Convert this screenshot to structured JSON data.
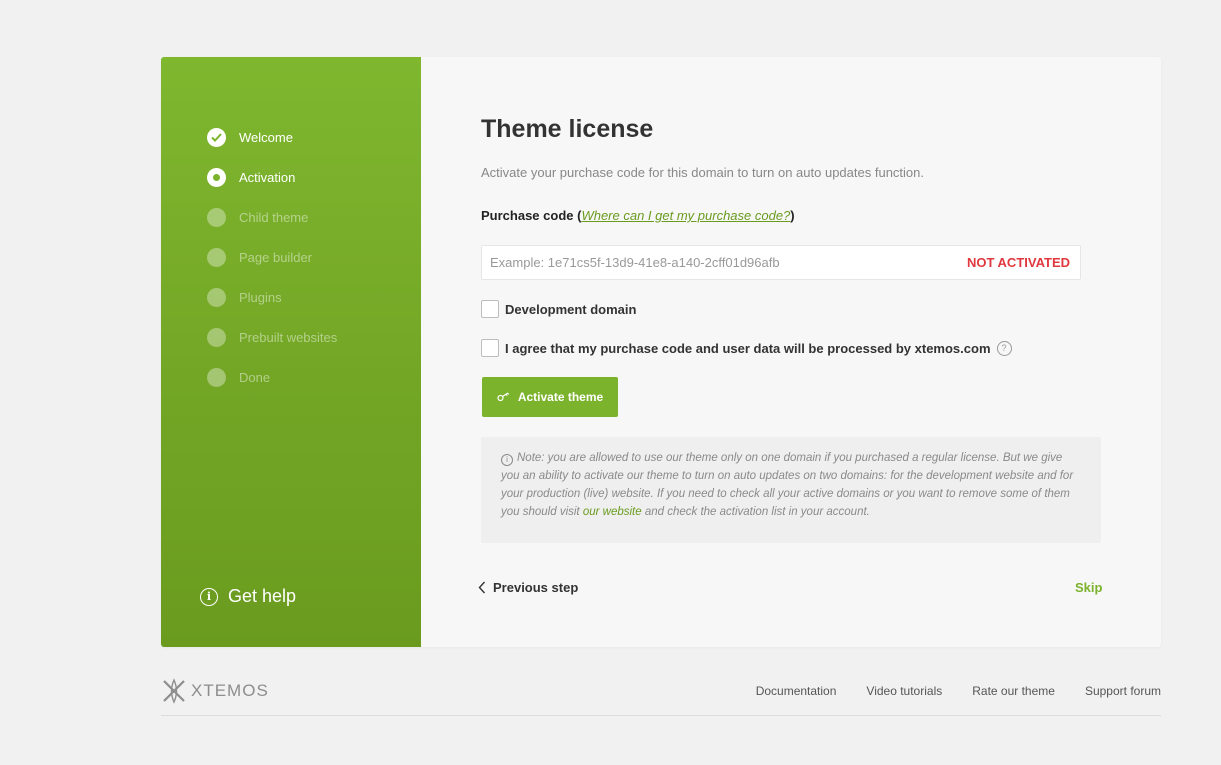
{
  "sidebar": {
    "steps": [
      {
        "label": "Welcome",
        "state": "done"
      },
      {
        "label": "Activation",
        "state": "active"
      },
      {
        "label": "Child theme",
        "state": "pending"
      },
      {
        "label": "Page builder",
        "state": "pending"
      },
      {
        "label": "Plugins",
        "state": "pending"
      },
      {
        "label": "Prebuilt websites",
        "state": "pending"
      },
      {
        "label": "Done",
        "state": "pending"
      }
    ],
    "help_label": "Get help"
  },
  "main": {
    "title": "Theme license",
    "subtitle": "Activate your purchase code for this domain to turn on auto updates function.",
    "purchase_label": "Purchase code",
    "purchase_link": "Where can I get my purchase code?",
    "code_input": {
      "value": "",
      "placeholder": "Example: 1e71cs5f-13d9-41e8-a140-2cff01d96afb"
    },
    "status": "NOT ACTIVATED",
    "dev_domain_label": "Development domain",
    "agree_label": "I agree that my purchase code and user data will be processed by xtemos.com",
    "activate_label": "Activate theme",
    "note": {
      "text_before": "Note: you are allowed to use our theme only on one domain if you purchased a regular license. But we give you an ability to activate our theme to turn on auto updates on two domains: for the development website and for your production (live) website. If you need to check all your active domains or you want to remove some of them you should visit ",
      "link": "our website",
      "text_after": " and check the activation list in your account."
    },
    "prev_label": "Previous step",
    "skip_label": "Skip"
  },
  "footer": {
    "logo_text": "XTEMOS",
    "links": [
      "Documentation",
      "Video tutorials",
      "Rate our theme",
      "Support forum"
    ]
  },
  "colors": {
    "accent": "#7cb32c",
    "status_error": "#e0383e"
  },
  "icons": {
    "done": "check-icon",
    "help": "info-circle-icon",
    "key": "key-icon",
    "prev": "chevron-left-icon",
    "question": "question-circle-icon",
    "note": "info-icon",
    "logo": "xtemos-logo-icon"
  }
}
